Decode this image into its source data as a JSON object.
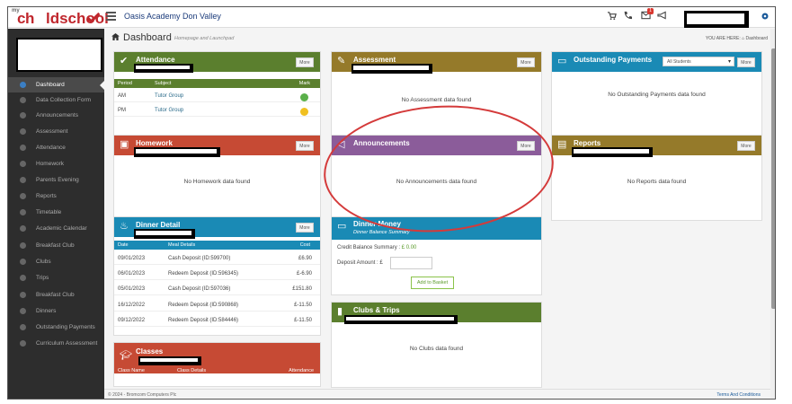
{
  "header": {
    "logo_my": "my",
    "logo_ch": "ch",
    "logo_school": "ldschool",
    "school_name": "Oasis Academy Don Valley",
    "notification_count": "1"
  },
  "breadcrumb": {
    "title": "Dashboard",
    "subtitle": "Homepage and Launchpad",
    "you_are_here": "YOU ARE HERE:",
    "current": "Dashboard"
  },
  "sidebar": {
    "items": [
      {
        "label": "Dashboard",
        "active": true
      },
      {
        "label": "Data Collection Form"
      },
      {
        "label": "Announcements"
      },
      {
        "label": "Assessment"
      },
      {
        "label": "Attendance"
      },
      {
        "label": "Homework"
      },
      {
        "label": "Parents Evening"
      },
      {
        "label": "Reports"
      },
      {
        "label": "Timetable"
      },
      {
        "label": "Academic Calendar"
      },
      {
        "label": "Breakfast Club"
      },
      {
        "label": "Clubs"
      },
      {
        "label": "Trips"
      },
      {
        "label": "Breakfast Club"
      },
      {
        "label": "Dinners"
      },
      {
        "label": "Outstanding Payments"
      },
      {
        "label": "Curriculum Assessment"
      }
    ]
  },
  "attendance": {
    "title": "Attendance",
    "more": "More",
    "columns": [
      "Period",
      "Subject",
      "Mark"
    ],
    "rows": [
      {
        "period": "AM",
        "subject": "Tutor Group",
        "mark": "present"
      },
      {
        "period": "PM",
        "subject": "Tutor Group",
        "mark": "unknown"
      }
    ]
  },
  "assessment": {
    "title": "Assessment",
    "more": "More",
    "empty": "No Assessment data found"
  },
  "outstanding": {
    "title": "Outstanding Payments",
    "select": "All Students",
    "more": "More",
    "empty": "No Outstanding Payments data found"
  },
  "homework": {
    "title": "Homework",
    "more": "More",
    "empty": "No Homework data found"
  },
  "announcements": {
    "title": "Announcements",
    "more": "More",
    "empty": "No Announcements data found"
  },
  "reports": {
    "title": "Reports",
    "more": "More",
    "empty": "No Reports data found"
  },
  "dinner_detail": {
    "title": "Dinner Detail",
    "more": "More",
    "columns": [
      "Date",
      "Meal Details",
      "Cost"
    ],
    "rows": [
      {
        "date": "09/01/2023",
        "detail": "Cash Deposit (ID:599700)",
        "cost": "£6.90"
      },
      {
        "date": "06/01/2023",
        "detail": "Redeem Deposit (ID:596345)",
        "cost": "£-6.90"
      },
      {
        "date": "05/01/2023",
        "detail": "Cash Deposit (ID:597036)",
        "cost": "£151.80"
      },
      {
        "date": "16/12/2022",
        "detail": "Redeem Deposit (ID:590868)",
        "cost": "£-11.50"
      },
      {
        "date": "09/12/2022",
        "detail": "Redeem Deposit (ID:584446)",
        "cost": "£-11.50"
      }
    ]
  },
  "dinner_money": {
    "title": "Dinner Money",
    "subtitle": "Dinner Balance Summary",
    "credit_label": "Credit Balance Summary :",
    "credit_value": "£ 0.00",
    "deposit_label": "Deposit Amount : £",
    "basket": "Add to Basket"
  },
  "clubs": {
    "title": "Clubs & Trips",
    "empty": "No Clubs data found"
  },
  "classes": {
    "title": "Classes",
    "columns": [
      "Class Name",
      "Class Details",
      "Attendance"
    ]
  },
  "footer": {
    "copyright": "© 2024 - Bromcom Computers Plc",
    "terms": "Terms And Conditions"
  },
  "colors": {
    "attendance": "#5b7f2e",
    "assessment": "#957a2a",
    "outstanding": "#1a8ab5",
    "homework": "#c64a34",
    "announcements": "#8b5c9a",
    "reports": "#957a2a",
    "dinner": "#1a8ab5",
    "clubs": "#5b7f2e",
    "classes": "#c64a34",
    "annotation": "#d43a3a"
  }
}
